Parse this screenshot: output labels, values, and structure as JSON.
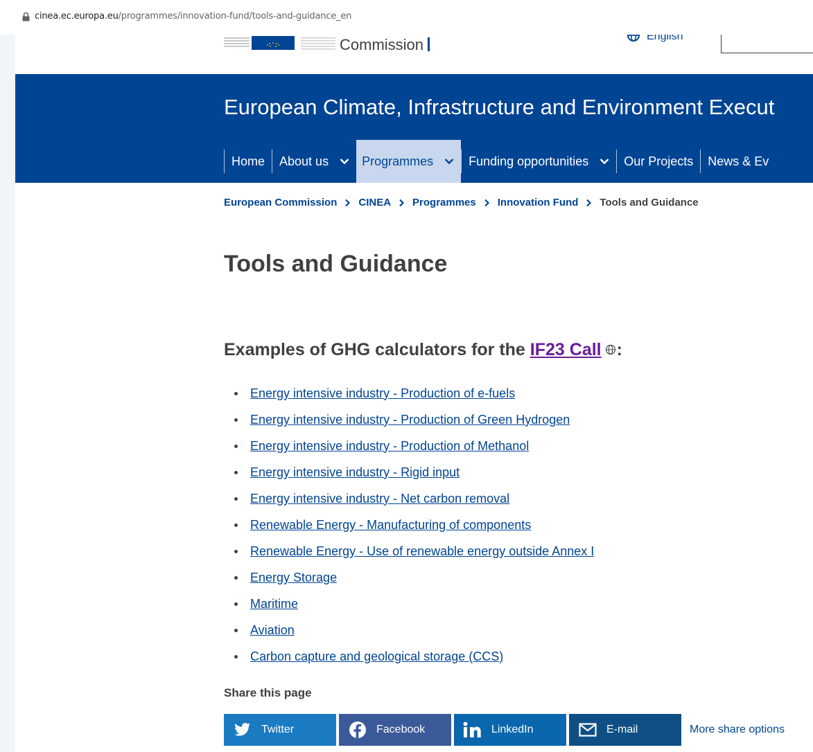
{
  "browser": {
    "url_host": "cinea.ec.europa.eu",
    "url_path": "/programmes/innovation-fund/tools-and-guidance_en"
  },
  "header": {
    "logo_text": "Commission",
    "language": "English"
  },
  "site_title": "European Climate, Infrastructure and Environment Execut",
  "nav": [
    {
      "label": "Home",
      "dropdown": false,
      "active": false
    },
    {
      "label": "About us",
      "dropdown": true,
      "active": false
    },
    {
      "label": "Programmes",
      "dropdown": true,
      "active": true
    },
    {
      "label": "Funding opportunities",
      "dropdown": true,
      "active": false
    },
    {
      "label": "Our Projects",
      "dropdown": false,
      "active": false
    },
    {
      "label": "News & Ev",
      "dropdown": false,
      "active": false
    }
  ],
  "breadcrumb": [
    "European Commission",
    "CINEA",
    "Programmes",
    "Innovation Fund",
    "Tools and Guidance"
  ],
  "page_title": "Tools and Guidance",
  "section": {
    "heading_prefix": "Examples of GHG calculators for the ",
    "heading_link": "IF23 Call",
    "heading_suffix": ":"
  },
  "calculators": [
    "Energy intensive industry - Production of e-fuels",
    "Energy intensive industry - Production of Green Hydrogen",
    "Energy intensive industry - Production of Methanol",
    "Energy intensive industry - Rigid input",
    "Energy intensive industry - Net carbon removal",
    "Renewable Energy - Manufacturing of components",
    "Renewable Energy - Use of renewable energy outside Annex I",
    "Energy Storage",
    "Maritime",
    "Aviation",
    "Carbon capture and geological storage (CCS)"
  ],
  "share": {
    "heading": "Share this page",
    "buttons": [
      {
        "label": "Twitter",
        "icon": "twitter-icon"
      },
      {
        "label": "Facebook",
        "icon": "facebook-icon"
      },
      {
        "label": "LinkedIn",
        "icon": "linkedin-icon"
      },
      {
        "label": "E-mail",
        "icon": "email-icon"
      }
    ],
    "more": "More share options"
  },
  "colors": {
    "brand_blue": "#004494",
    "active_nav": "#c8d7ee",
    "visited_link": "#6b1c9a"
  }
}
